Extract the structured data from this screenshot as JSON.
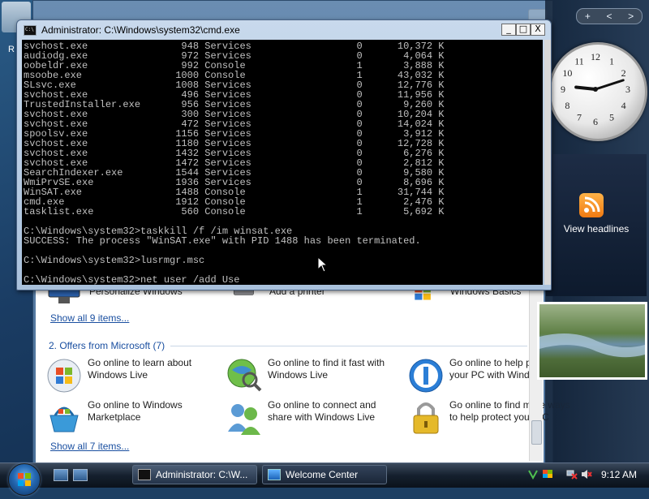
{
  "desktop": {
    "partial_label": "R"
  },
  "sidebar": {
    "controls": [
      "+",
      "<",
      ">"
    ],
    "clock": {
      "hour": 9,
      "minute": 12
    },
    "feed_gadget": {
      "label": "View headlines"
    }
  },
  "cmd": {
    "title": "Administrator: C:\\Windows\\system32\\cmd.exe",
    "buttons": {
      "minimize": "_",
      "maximize": "□",
      "close": "X"
    },
    "process_rows": [
      [
        "svchost.exe",
        "948",
        "Services",
        "0",
        "10,372 K"
      ],
      [
        "audiodg.exe",
        "972",
        "Services",
        "0",
        "4,064 K"
      ],
      [
        "oobeldr.exe",
        "992",
        "Console",
        "1",
        "3,888 K"
      ],
      [
        "msoobe.exe",
        "1000",
        "Console",
        "1",
        "43,032 K"
      ],
      [
        "SLsvc.exe",
        "1008",
        "Services",
        "0",
        "12,776 K"
      ],
      [
        "svchost.exe",
        "496",
        "Services",
        "0",
        "11,956 K"
      ],
      [
        "TrustedInstaller.exe",
        "956",
        "Services",
        "0",
        "9,260 K"
      ],
      [
        "svchost.exe",
        "300",
        "Services",
        "0",
        "10,204 K"
      ],
      [
        "svchost.exe",
        "472",
        "Services",
        "0",
        "14,024 K"
      ],
      [
        "spoolsv.exe",
        "1156",
        "Services",
        "0",
        "3,912 K"
      ],
      [
        "svchost.exe",
        "1180",
        "Services",
        "0",
        "12,728 K"
      ],
      [
        "svchost.exe",
        "1432",
        "Services",
        "0",
        "6,276 K"
      ],
      [
        "svchost.exe",
        "1472",
        "Services",
        "0",
        "2,812 K"
      ],
      [
        "SearchIndexer.exe",
        "1544",
        "Services",
        "0",
        "9,580 K"
      ],
      [
        "WmiPrvSE.exe",
        "1936",
        "Services",
        "0",
        "8,696 K"
      ],
      [
        "WinSAT.exe",
        "1488",
        "Console",
        "1",
        "31,744 K"
      ],
      [
        "cmd.exe",
        "1912",
        "Console",
        "1",
        "2,476 K"
      ],
      [
        "tasklist.exe",
        "560",
        "Console",
        "1",
        "5,692 K"
      ]
    ],
    "after_lines": [
      "",
      "C:\\Windows\\system32>taskkill /f /im winsat.exe",
      "SUCCESS: The process \"WinSAT.exe\" with PID 1488 has been terminated.",
      "",
      "C:\\Windows\\system32>lusrmgr.msc",
      "",
      "C:\\Windows\\system32>net user /add Use"
    ]
  },
  "welcome": {
    "partial_row": {
      "personalize": "Personalize Windows",
      "printer": "Add a printer",
      "basics": "Windows Basics"
    },
    "show_all_1": "Show all 9 items...",
    "section2_title": "2. Offers from Microsoft (7)",
    "offers": [
      {
        "icon": "windows-live-globe-icon",
        "text": "Go online to learn about Windows Live"
      },
      {
        "icon": "globe-search-icon",
        "text": "Go online to find it fast with Windows Live"
      },
      {
        "icon": "help-info-icon",
        "text": "Go online to help protect your PC with Windows Live"
      },
      {
        "icon": "shopping-basket-icon",
        "text": "Go online to Windows Marketplace"
      },
      {
        "icon": "people-icon",
        "text": "Go online to connect and share with Windows Live"
      },
      {
        "icon": "padlock-icon",
        "text": "Go online to find more ways to help protect your PC"
      }
    ],
    "show_all_2": "Show all 7 items..."
  },
  "taskbar": {
    "buttons": [
      {
        "label": "Administrator: C:\\W...",
        "icon": "cmd-icon"
      },
      {
        "label": "Welcome Center",
        "icon": "welcome-center-icon"
      }
    ],
    "clock": "9:12 AM"
  },
  "colors": {
    "console_bg": "#000000",
    "console_text": "#c0c0c0",
    "link_blue": "#1a4fa0"
  }
}
